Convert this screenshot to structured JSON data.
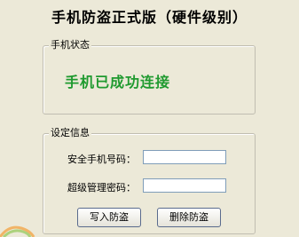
{
  "title": "手机防盗正式版（硬件级别）",
  "status_group": {
    "legend": "手机状态",
    "status_text": "手机已成功连接",
    "status_color": "#1f9a2f"
  },
  "settings_group": {
    "legend": "设定信息",
    "phone_label": "安全手机号码：",
    "phone_value": "",
    "admin_label": "超级管理密码：",
    "admin_value": "",
    "write_button": "写入防盗",
    "delete_button": "删除防盗"
  },
  "colors": {
    "background": "#ece9d8"
  },
  "icons": {
    "corner": "decorative-swirl-icon"
  }
}
